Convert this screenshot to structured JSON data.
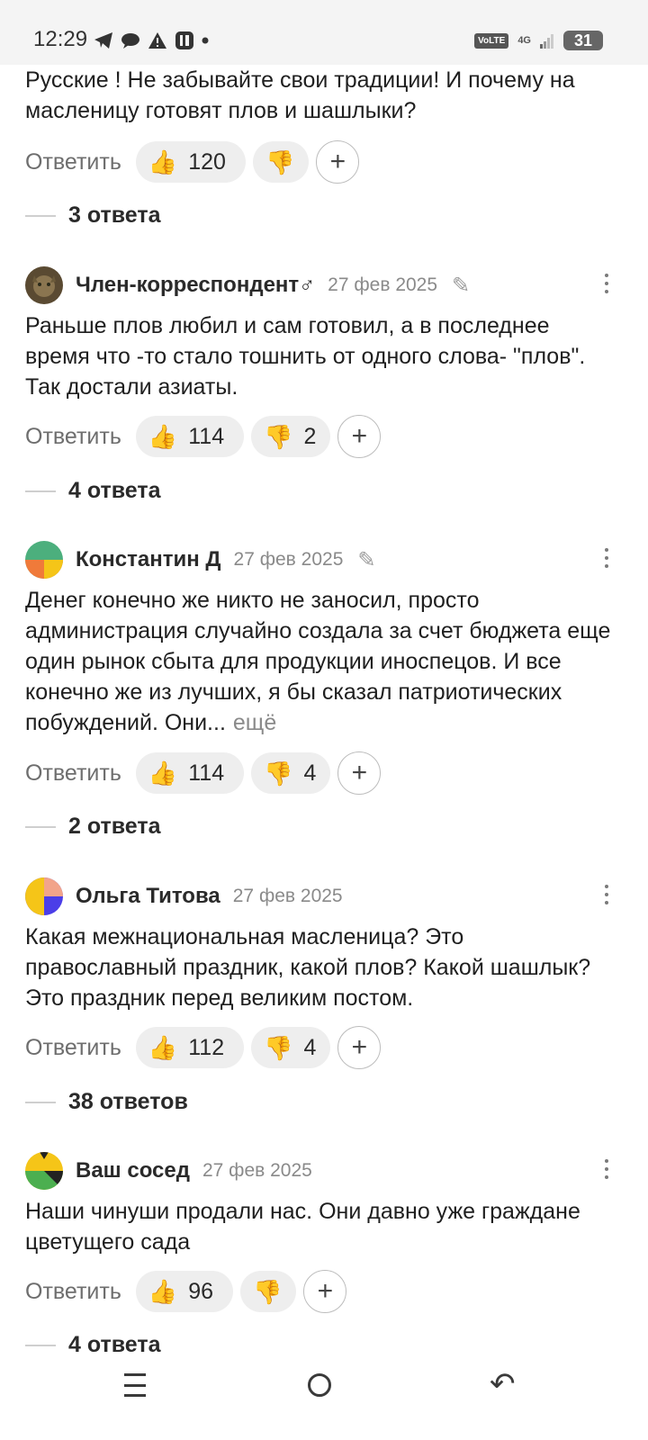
{
  "status_bar": {
    "time": "12:29",
    "volte": "VoLTE",
    "network": "4G",
    "battery": "31"
  },
  "comments": [
    {
      "text": "Русские ! Не забывайте свои традиции! И почему на масленицу готовят плов и шашлыки?",
      "reply_label": "Ответить",
      "likes": "120",
      "dislikes": "",
      "replies": "3 ответа"
    },
    {
      "author": "Член-корреспондент♂",
      "date": "27 фев 2025",
      "text": "Раньше плов любил и сам готовил, а в последнее время что -то стало тошнить от одного слова- \"плов\". Так достали азиаты.",
      "reply_label": "Ответить",
      "likes": "114",
      "dislikes": "2",
      "replies": "4 ответа"
    },
    {
      "author": "Константин Д",
      "date": "27 фев 2025",
      "text": "Денег конечно же никто не заносил, просто администрация случайно создала за счет бюджета еще один рынок сбыта для продукции иноспецов. И все конечно же из лучших, я бы сказал патриотических побуждений. Они...",
      "more": "ещё",
      "reply_label": "Ответить",
      "likes": "114",
      "dislikes": "4",
      "replies": "2 ответа"
    },
    {
      "author": "Ольга Титова",
      "date": "27 фев 2025",
      "text": "Какая межнациональная масленица? Это православный праздник, какой плов? Какой шашлык? Это праздник перед великим постом.",
      "reply_label": "Ответить",
      "likes": "112",
      "dislikes": "4",
      "replies": "38 ответов"
    },
    {
      "author": "Ваш сосед",
      "date": "27 фев 2025",
      "text": "Наши чинуши продали нас. Они давно уже граждане цветущего сада",
      "reply_label": "Ответить",
      "likes": "96",
      "dislikes": "",
      "replies": "4 ответа"
    }
  ],
  "icons": {
    "thumb_up": "thumbs-up-icon",
    "thumb_down": "thumbs-down-icon",
    "add_reaction": "plus-icon",
    "edit": "pencil-icon",
    "menu": "more-vert-icon"
  }
}
